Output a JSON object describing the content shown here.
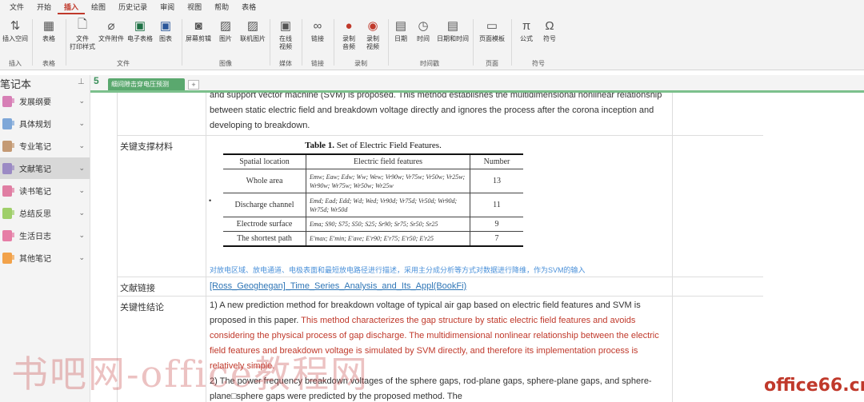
{
  "menu": [
    "文件",
    "开始",
    "插入",
    "绘图",
    "历史记录",
    "审阅",
    "视图",
    "帮助",
    "表格"
  ],
  "ribbon": {
    "groups": {
      "insert": "插入",
      "table": "表格",
      "file": "文件",
      "image": "图像",
      "media": "媒体",
      "link": "链接",
      "record": "录制",
      "time": "时间戳",
      "page": "页面",
      "symbol": "符号"
    },
    "buttons": {
      "insert_space": "插入空间",
      "table": "表格",
      "file_print": "文件\n打印样式",
      "attachment": "文件附件",
      "spreadsheet": "电子表格",
      "diagram": "图表",
      "screenshot": "屏幕剪辑",
      "picture": "图片",
      "online_picture": "联机图片",
      "online_video": "在线\n视频",
      "link": "链接",
      "record_audio": "录制\n音频",
      "record_video": "录制\n视频",
      "date": "日期",
      "time": "时间",
      "datetime": "日期和时间",
      "page_template": "页面模板",
      "equation": "公式",
      "symbol": "符号"
    }
  },
  "notebook": {
    "title": "笔记本",
    "sections": [
      {
        "label": "发展纲要",
        "color": "#d77fb6"
      },
      {
        "label": "具体规划",
        "color": "#7ea7d8"
      },
      {
        "label": "专业笔记",
        "color": "#c49a74"
      },
      {
        "label": "文献笔记",
        "color": "#9b8ac4"
      },
      {
        "label": "读书笔记",
        "color": "#e07ea3"
      },
      {
        "label": "总结反思",
        "color": "#9fcf6a"
      },
      {
        "label": "生活日志",
        "color": "#e67ea6"
      },
      {
        "label": "其他笔记",
        "color": "#f2a24a"
      }
    ]
  },
  "page_tab": {
    "number": "5",
    "title": "细间隙击穿电压预测",
    "add": "+"
  },
  "content": {
    "intro_text": "and support vector machine (SVM) is proposed. This method establishes the multidimensional nonlinear relationship between static electric field and breakdown voltage directly and ignores the process after the corona inception and developing to breakdown.",
    "row_material_label": "关键支撑材料",
    "row_link_label": "文献链接",
    "row_conclusion_label": "关键性结论",
    "link_text": "[Ross_Geoghegan]_Time_Series_Analysis_and_Its_Appl(BookFi)",
    "note_text": "对放电区域、放电通道、电极表面和最短放电路径进行描述，采用主分成分析等方式对数据进行降维，作为SVM的输入",
    "conclusion_black1": "1) A new prediction method for breakdown voltage of typical air gap based on electric field features and SVM is proposed in this paper. ",
    "conclusion_red": "This method characterizes the gap structure by static electric field features and avoids considering the physical process of gap discharge. The multidimensional nonlinear relationship between the electric field features and breakdown voltage is simulated by SVM directly, and therefore its implementation process is relatively simple.",
    "conclusion_black2": "2) The power frequency breakdown voltages of the sphere gaps, rod-plane gaps, sphere-plane gaps, and sphere-plane□sphere gaps were predicted by the proposed method. The"
  },
  "embedded_table": {
    "caption_bold": "Table 1.",
    "caption_rest": " Set of Electric Field Features.",
    "headers": [
      "Spatial location",
      "Electric field features",
      "Number"
    ],
    "rows": [
      {
        "loc": "Whole area",
        "features": "Emw; Eaw; Edw; Ww; Wew; Vr90w; Vr75w; Vr50w; Vr25w; Wr90w; Wr75w; Wr50w; Wr25w",
        "num": "13"
      },
      {
        "loc": "Discharge channel",
        "features": "Emd; Ead; Edd; Wd; Wed; Vr90d; Vr75d; Vr50d; Wr90d; Wr75d; Wr50d",
        "num": "11"
      },
      {
        "loc": "Electrode surface",
        "features": "Ema; S90; S75; S50; S25; Sr90; Sr75; Sr50; Sr25",
        "num": "9"
      },
      {
        "loc": "The shortest path",
        "features": "E'max; E'min; E'ave; E'r90; E'r75; E'r50; E'r25",
        "num": "7"
      }
    ]
  },
  "watermarks": {
    "left": "书吧网-office教程网",
    "right": "office66.cn"
  }
}
